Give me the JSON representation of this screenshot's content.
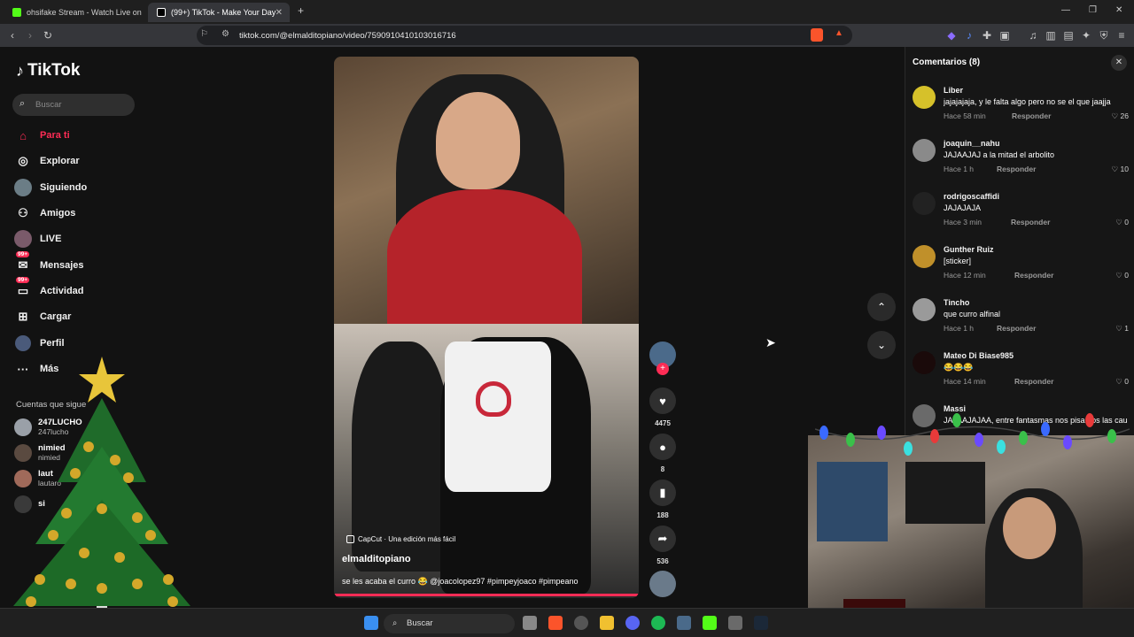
{
  "browser": {
    "tabs": [
      {
        "title": "ohsifake Stream - Watch Live on",
        "active": false
      },
      {
        "title": "(99+) TikTok - Make Your Day",
        "active": true
      }
    ],
    "url": "tiktok.com/@elmalditopiano/video/7590910410103016716"
  },
  "sidebar": {
    "logo": "TikTok",
    "search_placeholder": "Buscar",
    "items": [
      {
        "label": "Para ti",
        "icon": "home-icon",
        "active": true
      },
      {
        "label": "Explorar",
        "icon": "compass-icon"
      },
      {
        "label": "Siguiendo",
        "icon": "following-avatar-icon"
      },
      {
        "label": "Amigos",
        "icon": "friends-icon"
      },
      {
        "label": "LIVE",
        "icon": "live-icon"
      },
      {
        "label": "Mensajes",
        "icon": "messages-icon",
        "badge": "99+"
      },
      {
        "label": "Actividad",
        "icon": "activity-icon",
        "badge": "99+"
      },
      {
        "label": "Cargar",
        "icon": "upload-icon"
      },
      {
        "label": "Perfil",
        "icon": "profile-icon"
      },
      {
        "label": "Más",
        "icon": "more-icon"
      }
    ],
    "following_title": "Cuentas que sigue",
    "following": [
      {
        "name": "247LUCHO",
        "handle": "247lucho"
      },
      {
        "name": "nimied",
        "handle": "nimied"
      },
      {
        "name": "laut",
        "handle": "lautaro"
      },
      {
        "name": "si",
        "handle": ""
      }
    ]
  },
  "video": {
    "capcut": "CapCut · Una edición más fácil",
    "author": "elmalditopiano",
    "caption": "se les acaba el curro 😂 @joacolopez97 #pimpeyjoaco #pimpeano"
  },
  "actions": {
    "likes": "4475",
    "comments": "8",
    "saves": "188",
    "shares": "536"
  },
  "comments_panel": {
    "title": "Comentarios (8)",
    "reply_label": "Responder",
    "items": [
      {
        "user": "Liber",
        "text": "jajajajaja, y le falta algo pero no se el que jaajja",
        "meta": "Hace 58 min",
        "likes": "26"
      },
      {
        "user": "joaquin__nahu",
        "text": "JAJAAJAJ a la mitad el arbolito",
        "meta": "Hace 1 h",
        "likes": "10"
      },
      {
        "user": "rodrigoscaffidi",
        "text": "JAJAJAJA",
        "meta": "Hace 3 min",
        "likes": "0"
      },
      {
        "user": "Gunther Ruiz",
        "text": "[sticker]",
        "meta": "Hace 12 min",
        "likes": "0"
      },
      {
        "user": "Tincho",
        "text": "que curro alfinal",
        "meta": "Hace 1 h",
        "likes": "1"
      },
      {
        "user": "Mateo Di Biase985",
        "text": "😂😂😂",
        "meta": "Hace 14 min",
        "likes": "0"
      },
      {
        "user": "Massi",
        "text": "JAJAAJAJAA, entre fantasmas nos pisa nos las cau",
        "meta": "",
        "likes": ""
      }
    ]
  },
  "taskbar": {
    "search_label": "Buscar"
  },
  "colors": {
    "accent": "#fe2c55",
    "page_bg": "#121212",
    "panel_bg": "#161616"
  }
}
